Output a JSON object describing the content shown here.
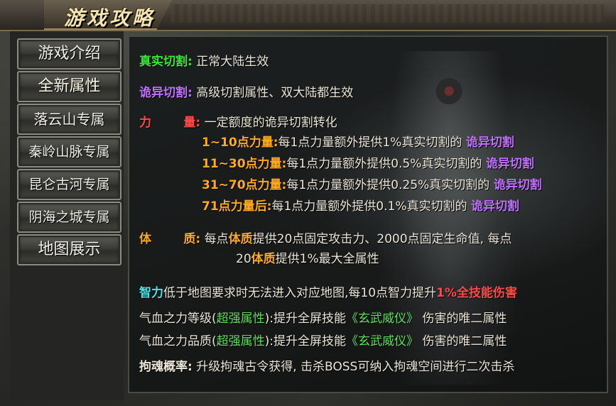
{
  "header": {
    "title": "游戏攻略"
  },
  "sidebar": {
    "items": [
      {
        "label": "游戏介绍"
      },
      {
        "label": "全新属性"
      },
      {
        "label": "落云山专属"
      },
      {
        "label": "秦岭山脉专属"
      },
      {
        "label": "昆仑古河专属"
      },
      {
        "label": "阴海之城专属"
      },
      {
        "label": "地图展示"
      }
    ],
    "active_index": 1
  },
  "content": {
    "real_cut": {
      "label": "真实切割",
      "colon": ":",
      "text": "正常大陆生效"
    },
    "weird_cut": {
      "label": "诡异切割",
      "colon": ":",
      "text": "高级切割属性、双大陆都生效"
    },
    "strength": {
      "label_a": "力",
      "label_b": "量",
      "colon": ":",
      "text": "一定额度的诡异切割转化",
      "tiers": [
        {
          "range": "1~10点力量:",
          "desc": "每1点力量额外提供1%真实切割的",
          "tail": "诡异切割"
        },
        {
          "range": "11~30点力量:",
          "desc": "每1点力量额外提供0.5%真实切割的",
          "tail": "诡异切割"
        },
        {
          "range": "31~70点力量:",
          "desc": "每1点力量额外提供0.25%真实切割的",
          "tail": "诡异切割"
        },
        {
          "range": "71点力量后:",
          "desc": "每1点力量额外提供0.1%真实切割的",
          "tail": "诡异切割"
        }
      ]
    },
    "physique": {
      "label_a": "体",
      "label_b": "质",
      "colon": ":",
      "line1_a": "每点",
      "line1_key": "体质",
      "line1_b": "提供20点固定攻击力、2000点固定生命值, 每点",
      "line2_a": "20",
      "line2_key": "体质",
      "line2_b": "提供1%最大全属性"
    },
    "intelligence": {
      "label": "智力",
      "text": "低于地图要求时无法进入对应地图,每10点智力提升",
      "highlight": "1%全技能伤害"
    },
    "qixue_level": {
      "prefix": "气血之力等级(",
      "tag": "超强属性",
      "mid": "):提升全屏技能",
      "skill": "《玄武威仪》",
      "suffix": "伤害的唯二属性"
    },
    "qixue_quality": {
      "prefix": "气血之力品质(",
      "tag": "超强属性",
      "mid": "):提升全屏技能",
      "skill": "《玄武威仪》",
      "suffix": "伤害的唯二属性"
    },
    "soul": {
      "label": "拘魂概率:",
      "text": "升级拘魂古令获得, 击杀BOSS可纳入拘魂空间进行二次击杀"
    }
  },
  "colors": {
    "green": "#39e83a",
    "purple": "#c070ff",
    "red": "#ff4a4a",
    "orange": "#ffaa20",
    "cyan": "#40e8e8"
  }
}
